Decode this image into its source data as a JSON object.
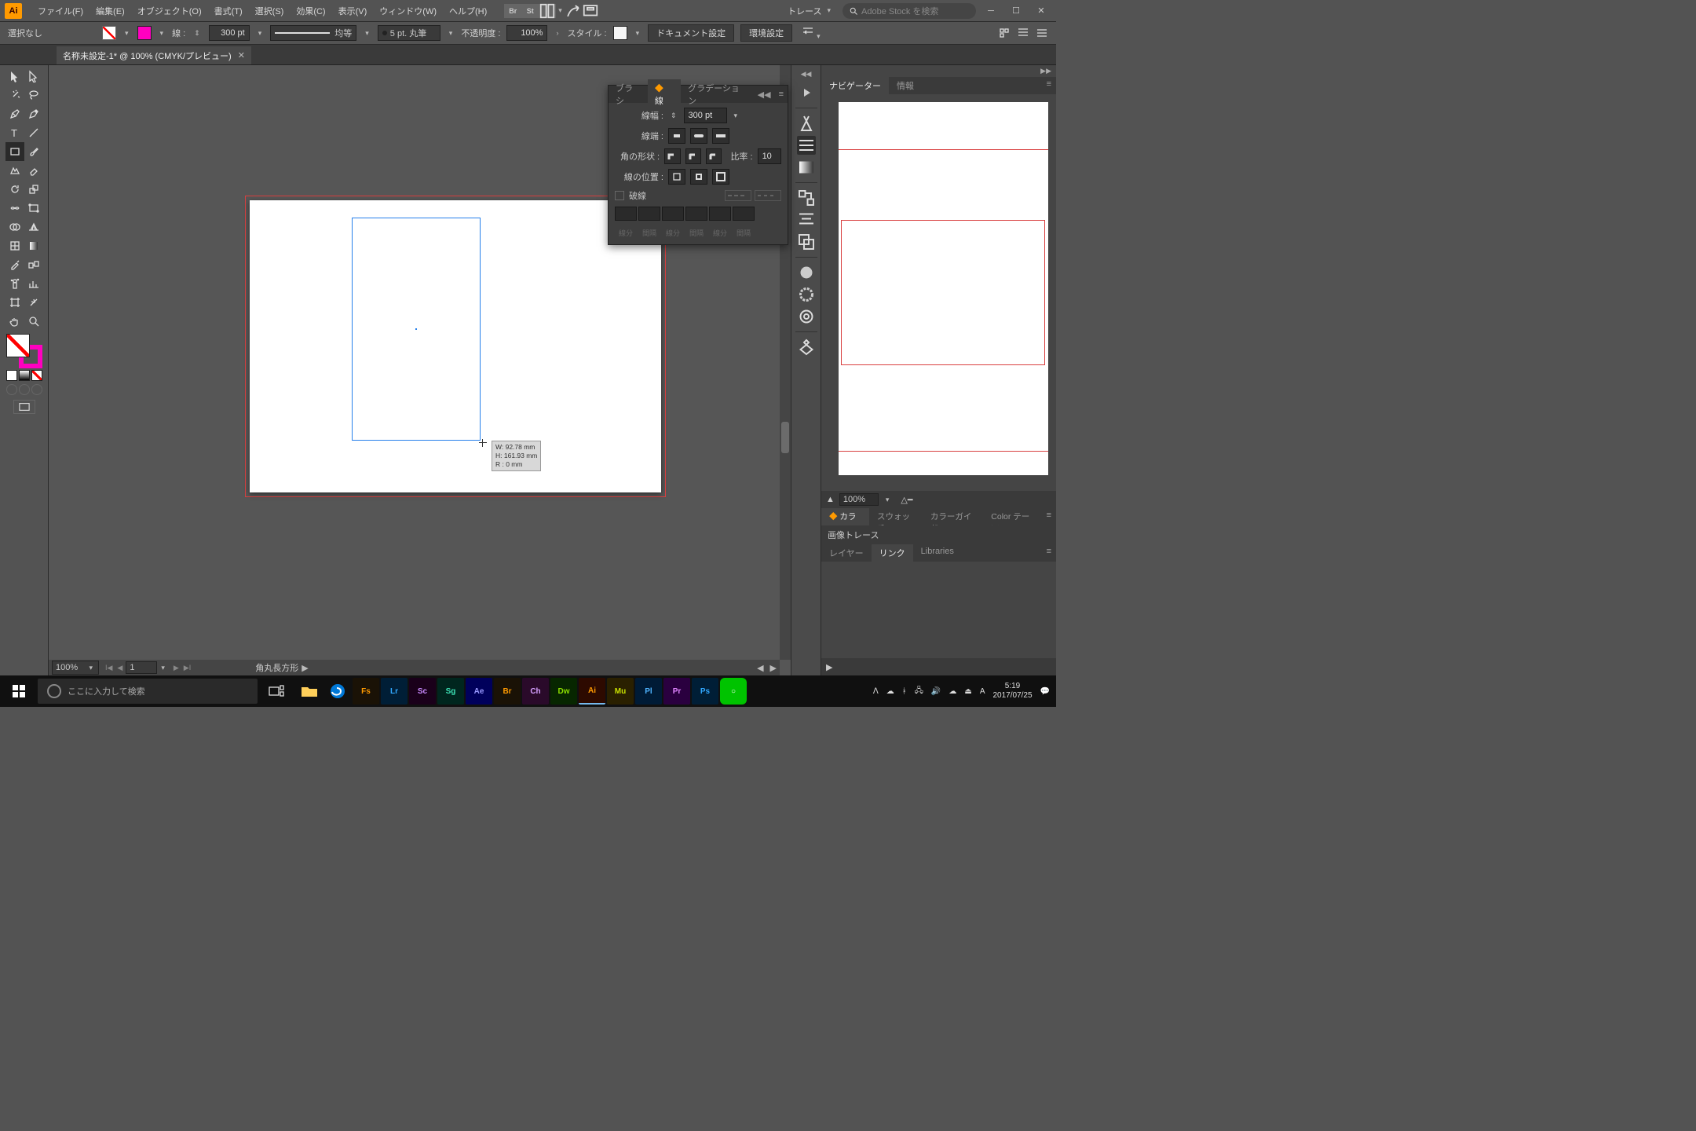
{
  "menu": {
    "items": [
      "ファイル(F)",
      "編集(E)",
      "オブジェクト(O)",
      "書式(T)",
      "選択(S)",
      "効果(C)",
      "表示(V)",
      "ウィンドウ(W)",
      "ヘルプ(H)"
    ],
    "trace_label": "トレース",
    "search_placeholder": "Adobe Stock を検索"
  },
  "control": {
    "selection": "選択なし",
    "stroke_label": "線 :",
    "stroke_weight": "300 pt",
    "profile": "均等",
    "brush": "5 pt. 丸筆",
    "opacity_label": "不透明度 :",
    "opacity": "100%",
    "style_label": "スタイル :",
    "doc_setup": "ドキュメント設定",
    "prefs": "環境設定"
  },
  "doc_tab": {
    "label": "名称未設定-1* @ 100% (CMYK/プレビュー)"
  },
  "smart_guide": {
    "w": "W: 92.78 mm",
    "h": "H: 161.93 mm",
    "r": "R : 0 mm"
  },
  "statusbar": {
    "zoom": "100%",
    "page": "1",
    "tool": "角丸長方形"
  },
  "nav_panel": {
    "tabs": [
      "ナビゲーター",
      "情報"
    ],
    "zoom": "100%"
  },
  "color_panel": {
    "tabs": [
      "カラー",
      "スウォッチ",
      "カラーガイド",
      "Color テーマ"
    ]
  },
  "trace_panel": {
    "title": "画像トレース"
  },
  "links_panel": {
    "tabs": [
      "レイヤー",
      "リンク",
      "Libraries"
    ]
  },
  "brush_panel": {
    "tabs": [
      "ブラシ",
      "線",
      "グラデーション"
    ],
    "weight_label": "線幅 :",
    "weight": "300 pt",
    "cap_label": "線端 :",
    "join_label": "角の形状 :",
    "miter_label": "比率 :",
    "miter": "10",
    "align_label": "線の位置 :",
    "dash_label": "破線",
    "dash_cells": [
      "線分",
      "間隔",
      "線分",
      "間隔",
      "線分",
      "間隔"
    ]
  },
  "taskbar": {
    "search_placeholder": "ここに入力して検索",
    "apps": [
      "Fs",
      "Lr",
      "Sc",
      "Sg",
      "Ae",
      "Br",
      "Ch",
      "Dw",
      "Ai",
      "Mu",
      "Pl",
      "Pr",
      "Ps"
    ],
    "ime": "A",
    "time": "5:19",
    "date": "2017/07/25"
  }
}
